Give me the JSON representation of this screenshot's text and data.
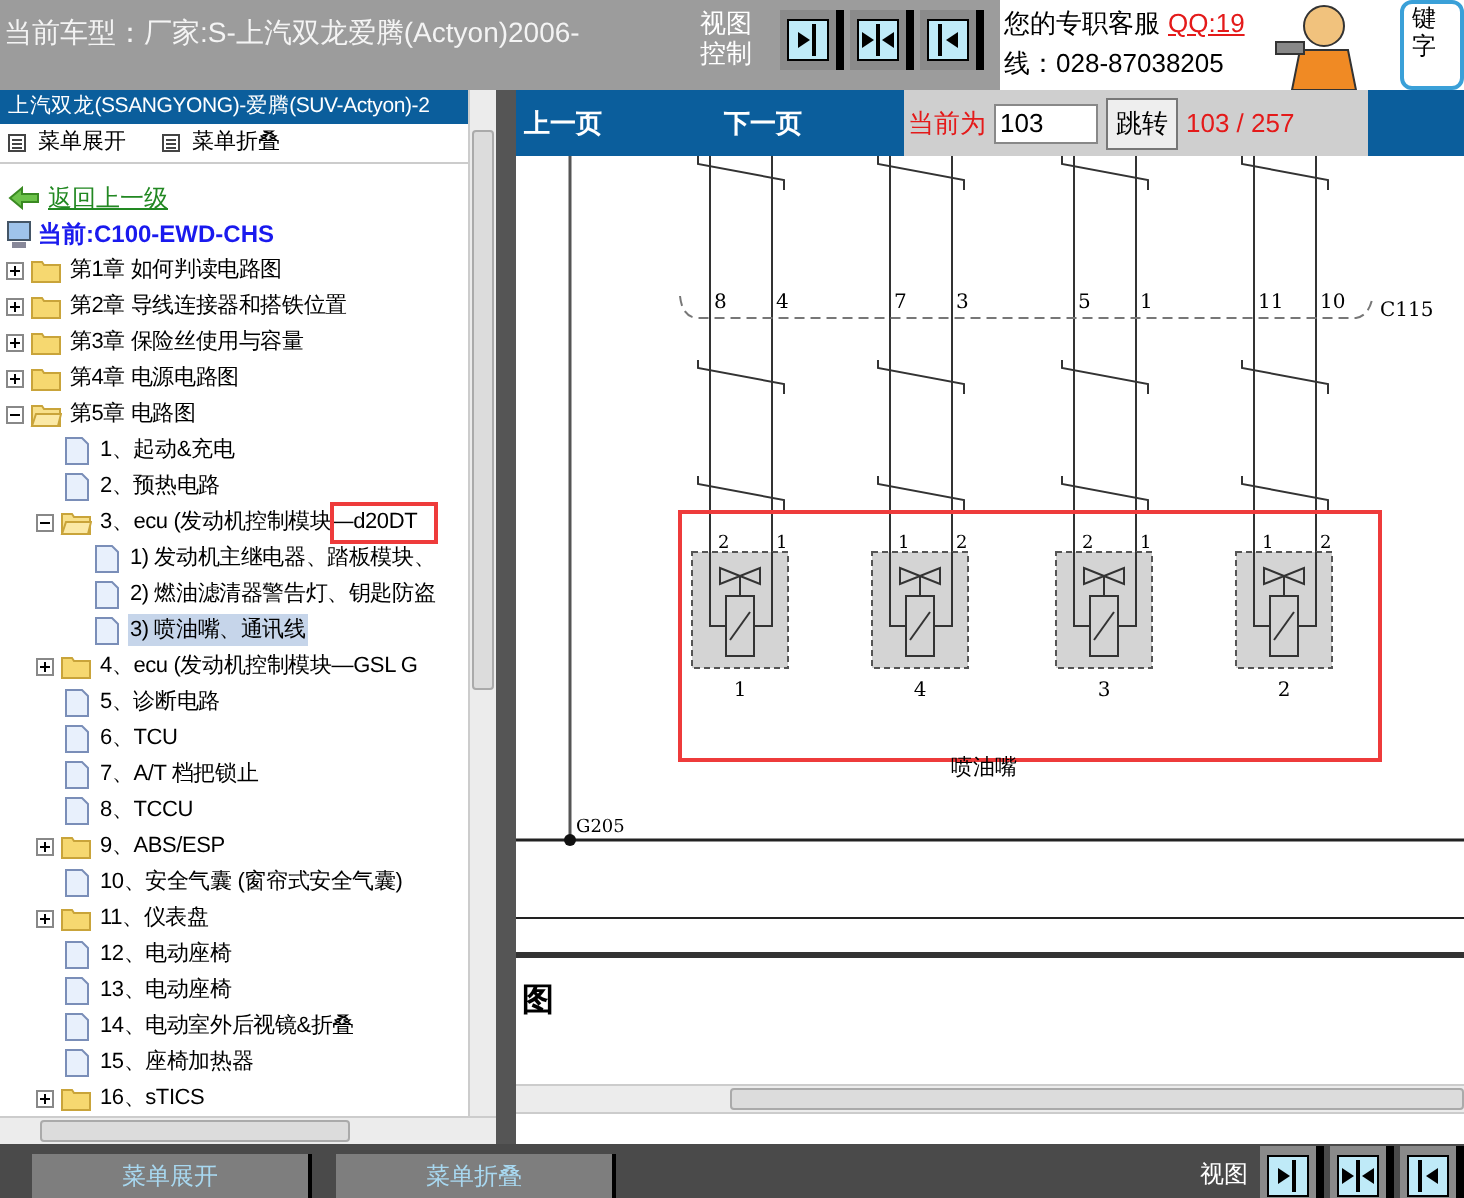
{
  "top_bar": {
    "vehicle": "当前车型：厂家:S-上汽双龙爱腾(Actyon)2006-",
    "view_control": "视图控制",
    "support_line1": "您的专职客服",
    "support_qq": "QQ:19",
    "support_line2": "线：028-87038205",
    "keyword_box": "键字"
  },
  "left_panel": {
    "title": "上汽双龙(SSANGYONG)-爱腾(SUV-Actyon)-2",
    "toolbar": [
      "菜单展开",
      "菜单折叠"
    ],
    "back_link": "返回上一级",
    "current": "当前:C100-EWD-CHS",
    "tree": [
      {
        "label": "第1章 如何判读电路图",
        "kind": "folder",
        "expanded": false,
        "selected": false
      },
      {
        "label": "第2章 导线连接器和搭铁位置",
        "kind": "folder",
        "expanded": false,
        "selected": false
      },
      {
        "label": "第3章 保险丝使用与容量",
        "kind": "folder",
        "expanded": false,
        "selected": false
      },
      {
        "label": "第4章 电源电路图",
        "kind": "folder",
        "expanded": false,
        "selected": false
      },
      {
        "label": "第5章 电路图",
        "kind": "folder",
        "expanded": true,
        "selected": false,
        "children": [
          {
            "label": "1、起动&充电",
            "kind": "page",
            "selected": false
          },
          {
            "label": "2、预热电路",
            "kind": "page",
            "selected": false
          },
          {
            "label": "3、ecu (发动机控制模块—d20DT",
            "kind": "folder",
            "expanded": true,
            "selected": false,
            "children": [
              {
                "label": "1) 发动机主继电器、踏板模块、",
                "kind": "page",
                "selected": false
              },
              {
                "label": "2) 燃油滤清器警告灯、钥匙防盗",
                "kind": "page",
                "selected": false
              },
              {
                "label": "3) 喷油嘴、通讯线",
                "kind": "page",
                "selected": true
              }
            ]
          },
          {
            "label": "4、ecu (发动机控制模块—GSL G",
            "kind": "folder",
            "expanded": false,
            "selected": false
          },
          {
            "label": "5、诊断电路",
            "kind": "page",
            "selected": false
          },
          {
            "label": "6、TCU",
            "kind": "page",
            "selected": false
          },
          {
            "label": "7、A/T 档把锁止",
            "kind": "page",
            "selected": false
          },
          {
            "label": "8、TCCU",
            "kind": "page",
            "selected": false
          },
          {
            "label": "9、ABS/ESP",
            "kind": "folder",
            "expanded": false,
            "selected": false
          },
          {
            "label": "10、安全气囊 (窗帘式安全气囊)",
            "kind": "page",
            "selected": false
          },
          {
            "label": "11、仪表盘",
            "kind": "folder",
            "expanded": false,
            "selected": false
          },
          {
            "label": "12、电动座椅",
            "kind": "page",
            "selected": false
          },
          {
            "label": "13、电动座椅",
            "kind": "page",
            "selected": false
          },
          {
            "label": "14、电动室外后视镜&折叠",
            "kind": "page",
            "selected": false
          },
          {
            "label": "15、座椅加热器",
            "kind": "page",
            "selected": false
          },
          {
            "label": "16、sTICS",
            "kind": "folder",
            "expanded": false,
            "selected": false
          }
        ]
      }
    ]
  },
  "viewer": {
    "prev": "上一页",
    "next": "下一页",
    "current_label": "当前为",
    "page_input": "103",
    "go_button": "跳转",
    "page_count": "103 / 257",
    "diagram": {
      "connector": "C115",
      "connector_pins": [
        "8",
        "4",
        "7",
        "3",
        "5",
        "1",
        "11",
        "10"
      ],
      "injectors": [
        {
          "label": "1",
          "pins": [
            "2",
            "1"
          ]
        },
        {
          "label": "4",
          "pins": [
            "1",
            "2"
          ]
        },
        {
          "label": "3",
          "pins": [
            "2",
            "1"
          ]
        },
        {
          "label": "2",
          "pins": [
            "1",
            "2"
          ]
        }
      ],
      "caption": "喷油嘴",
      "ground": "G205"
    },
    "section_title": "图"
  },
  "bottom_bar": {
    "buttons": [
      "菜单展开",
      "菜单折叠"
    ],
    "view_control": "视图"
  }
}
